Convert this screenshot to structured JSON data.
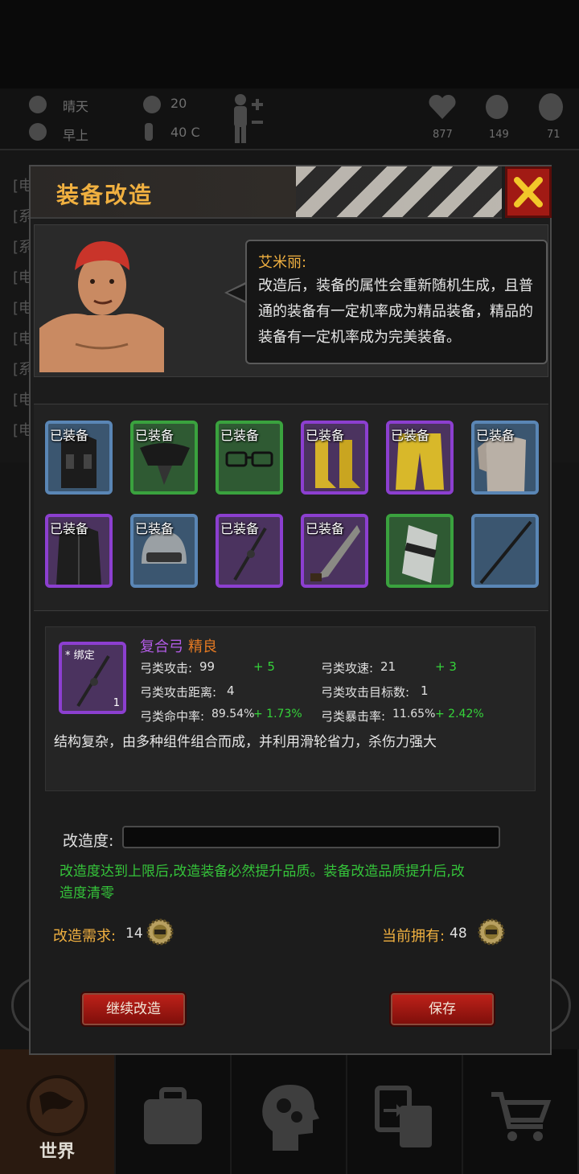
{
  "status_bar": {
    "weather": "晴天",
    "time_of_day": "早上",
    "radiation": "20",
    "temperature": "40 C",
    "health": "877",
    "hunger": "149",
    "sanity": "71"
  },
  "background_log": [
    "[电",
    "[系",
    "[系",
    "[电",
    "[电",
    "[电",
    "[系",
    "[电",
    "[电"
  ],
  "dialog": {
    "title": "装备改造",
    "close_icon": "close-x-icon",
    "npc": {
      "speaker": "艾米丽:",
      "speech": "改造后，装备的属性会重新随机生成，且普通的装备有一定机率成为精品装备，精品的装备有一定机率成为完美装备。"
    },
    "equip_tag": "已装备",
    "slots": [
      {
        "item": "tactical-vest-icon",
        "rarity": "blue",
        "equipped": true
      },
      {
        "item": "gas-mask-icon",
        "rarity": "green",
        "equipped": true
      },
      {
        "item": "glasses-icon",
        "rarity": "green",
        "equipped": true
      },
      {
        "item": "yellow-boots-icon",
        "rarity": "purple",
        "equipped": true
      },
      {
        "item": "yellow-pants-icon",
        "rarity": "purple",
        "equipped": true
      },
      {
        "item": "torso-icon",
        "rarity": "blue",
        "equipped": true
      },
      {
        "item": "coat-icon",
        "rarity": "purple",
        "equipped": true
      },
      {
        "item": "helmet-icon",
        "rarity": "blue",
        "equipped": true
      },
      {
        "item": "compound-bow-icon",
        "rarity": "purple",
        "equipped": true
      },
      {
        "item": "machete-icon",
        "rarity": "purple",
        "equipped": true
      },
      {
        "item": "riot-shield-icon",
        "rarity": "green",
        "equipped": false
      },
      {
        "item": "staff-icon",
        "rarity": "blue",
        "equipped": false
      }
    ],
    "detail": {
      "bind_tag": "* 绑定",
      "quantity": "1",
      "name": "复合弓",
      "quality": "精良",
      "stats": [
        {
          "label": "弓类攻击:",
          "value": "99",
          "bonus": "+ 5"
        },
        {
          "label": "弓类攻速:",
          "value": "21",
          "bonus": "+ 3"
        },
        {
          "label": "弓类攻击距离:",
          "value": "4",
          "bonus": ""
        },
        {
          "label": "弓类攻击目标数:",
          "value": "1",
          "bonus": ""
        },
        {
          "label": "弓类命中率:",
          "value": "89.54%",
          "bonus": "+ 1.73%"
        },
        {
          "label": "弓类暴击率:",
          "value": "11.65%",
          "bonus": "+ 2.42%"
        }
      ],
      "description": "结构复杂，由多种组件组合而成，并利用滑轮省力，杀伤力强大"
    },
    "progress": {
      "label": "改造度:",
      "fraction": 0
    },
    "note": "改造度达到上限后,改造装备必然提升品质。装备改造品质提升后,改造度清零",
    "requirement": {
      "label": "改造需求:",
      "value": "14"
    },
    "owned": {
      "label": "当前拥有:",
      "value": "48"
    },
    "buttons": {
      "continue": "继续改造",
      "save": "保存"
    }
  },
  "bottom_nav": {
    "world": "世界"
  },
  "colors": {
    "accent": "#f0b040",
    "bonus_green": "#35d43a",
    "purple": "#8c3fd0",
    "danger": "#a11a14"
  }
}
